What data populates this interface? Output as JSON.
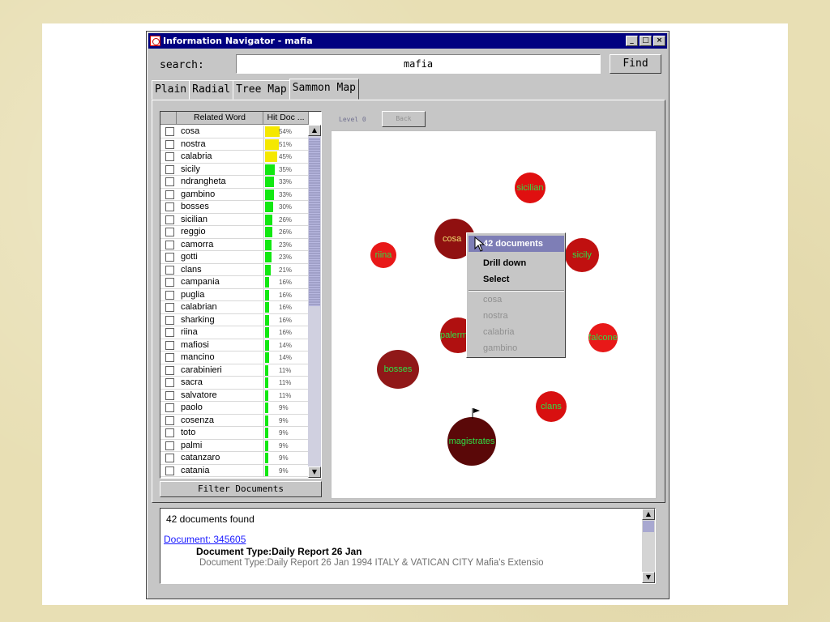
{
  "window": {
    "title": "Information Navigator - mafia",
    "controls": [
      "_",
      "□",
      "×"
    ]
  },
  "search": {
    "label": "search:",
    "value": "mafia",
    "find_label": "Find"
  },
  "tabs": [
    {
      "label": "Plain",
      "active": false
    },
    {
      "label": "Radial",
      "active": false
    },
    {
      "label": "Tree Map",
      "active": false
    },
    {
      "label": "Sammon Map",
      "active": true
    }
  ],
  "table": {
    "columns": [
      "Related Word",
      "Hit Doc ..."
    ],
    "rows": [
      {
        "word": "cosa",
        "pct": "54%",
        "color": "#f5e800"
      },
      {
        "word": "nostra",
        "pct": "51%",
        "color": "#f5e800"
      },
      {
        "word": "calabria",
        "pct": "45%",
        "color": "#f5e800"
      },
      {
        "word": "sicily",
        "pct": "35%",
        "color": "#12e812"
      },
      {
        "word": "ndrangheta",
        "pct": "33%",
        "color": "#12e812"
      },
      {
        "word": "gambino",
        "pct": "33%",
        "color": "#12e812"
      },
      {
        "word": "bosses",
        "pct": "30%",
        "color": "#12e812"
      },
      {
        "word": "sicilian",
        "pct": "26%",
        "color": "#12e812"
      },
      {
        "word": "reggio",
        "pct": "26%",
        "color": "#12e812"
      },
      {
        "word": "camorra",
        "pct": "23%",
        "color": "#12e812"
      },
      {
        "word": "gotti",
        "pct": "23%",
        "color": "#12e812"
      },
      {
        "word": "clans",
        "pct": "21%",
        "color": "#12e812"
      },
      {
        "word": "campania",
        "pct": "16%",
        "color": "#12e812"
      },
      {
        "word": "puglia",
        "pct": "16%",
        "color": "#12e812"
      },
      {
        "word": "calabrian",
        "pct": "16%",
        "color": "#12e812"
      },
      {
        "word": "sharking",
        "pct": "16%",
        "color": "#12e812"
      },
      {
        "word": "riina",
        "pct": "16%",
        "color": "#12e812"
      },
      {
        "word": "mafiosi",
        "pct": "14%",
        "color": "#12e812"
      },
      {
        "word": "mancino",
        "pct": "14%",
        "color": "#12e812"
      },
      {
        "word": "carabinieri",
        "pct": "11%",
        "color": "#12e812"
      },
      {
        "word": "sacra",
        "pct": "11%",
        "color": "#12e812"
      },
      {
        "word": "salvatore",
        "pct": "11%",
        "color": "#12e812"
      },
      {
        "word": "paolo",
        "pct": "9%",
        "color": "#12e812"
      },
      {
        "word": "cosenza",
        "pct": "9%",
        "color": "#12e812"
      },
      {
        "word": "toto",
        "pct": "9%",
        "color": "#12e812"
      },
      {
        "word": "palmi",
        "pct": "9%",
        "color": "#12e812"
      },
      {
        "word": "catanzaro",
        "pct": "9%",
        "color": "#12e812"
      },
      {
        "word": "catania",
        "pct": "9%",
        "color": "#12e812"
      }
    ],
    "filter_label": "Filter Documents"
  },
  "map": {
    "level_label": "Level 0",
    "back_label": "Back",
    "nodes": [
      {
        "label": "sicilian",
        "color": "#e01010"
      },
      {
        "label": "cosa",
        "color": "#901010"
      },
      {
        "label": "riina",
        "color": "#e81818"
      },
      {
        "label": "sicily",
        "color": "#c01010"
      },
      {
        "label": "palermo",
        "color": "#b01010"
      },
      {
        "label": "falcone",
        "color": "#e81818"
      },
      {
        "label": "bosses",
        "color": "#901818"
      },
      {
        "label": "clans",
        "color": "#d81010"
      },
      {
        "label": "magistrates",
        "color": "#5a0808"
      }
    ],
    "context_menu": {
      "header": "42 documents",
      "actions": [
        "Drill down",
        "Select"
      ],
      "disabled_items": [
        "cosa",
        "nostra",
        "calabria",
        "gambino"
      ]
    }
  },
  "results": {
    "count_text": "42 documents found",
    "link": "Document: 345605",
    "type": "Document Type:Daily Report 26 Jan",
    "snippet": "Document Type:Daily Report 26 Jan 1994 ITALY & VATICAN CITY Mafia's Extensio"
  }
}
